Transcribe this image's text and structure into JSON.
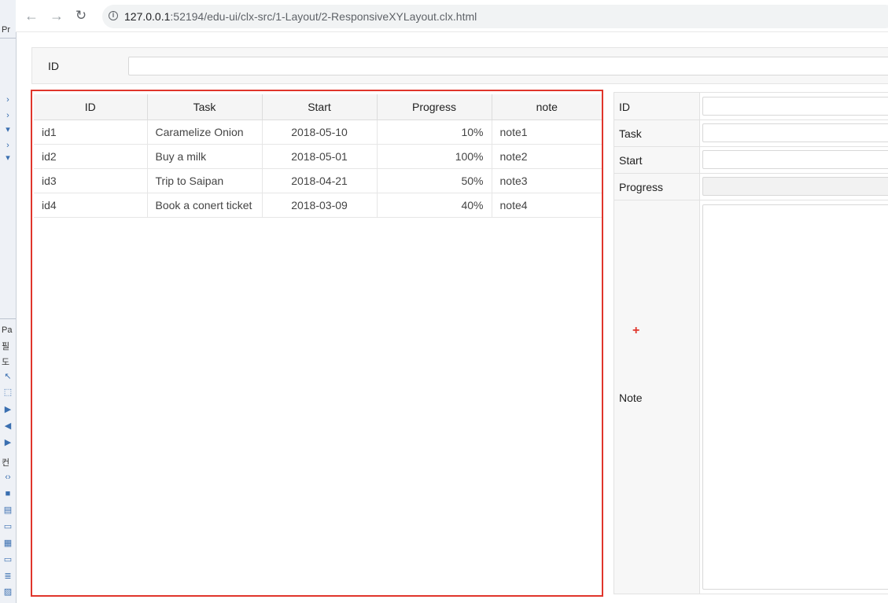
{
  "browser": {
    "url_host": "127.0.0.1",
    "url_path": ":52194/edu-ui/clx-src/1-Layout/2-ResponsiveXYLayout.clx.html",
    "back_icon": "arrow-left-icon",
    "forward_icon": "arrow-right-icon",
    "reload_icon": "reload-icon",
    "info_icon": "info-icon"
  },
  "ide_strip": {
    "labels": [
      "Pr",
      "Pa",
      "필",
      "도",
      "컨"
    ]
  },
  "search": {
    "label": "ID",
    "value": ""
  },
  "grid": {
    "columns": [
      "ID",
      "Task",
      "Start",
      "Progress",
      "note"
    ],
    "rows": [
      {
        "id": "id1",
        "task": "Caramelize Onion",
        "start": "2018-05-10",
        "progress": "10%",
        "note": "note1"
      },
      {
        "id": "id2",
        "task": "Buy a milk",
        "start": "2018-05-01",
        "progress": "100%",
        "note": "note2"
      },
      {
        "id": "id3",
        "task": "Trip to Saipan",
        "start": "2018-04-21",
        "progress": "50%",
        "note": "note3"
      },
      {
        "id": "id4",
        "task": "Book a conert ticket",
        "start": "2018-03-09",
        "progress": "40%",
        "note": "note4"
      }
    ],
    "highlight_color": "#e0352b"
  },
  "form": {
    "id_label": "ID",
    "task_label": "Task",
    "start_label": "Start",
    "progress_label": "Progress",
    "note_label": "Note",
    "plus_marker": "+"
  }
}
